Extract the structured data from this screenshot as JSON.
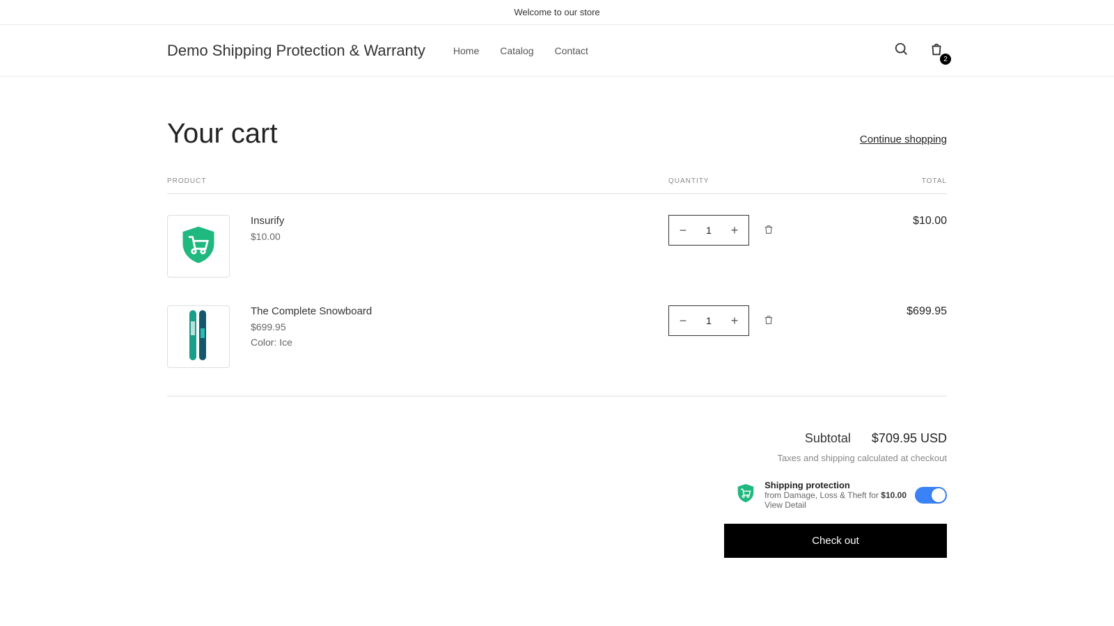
{
  "announcement": "Welcome to our store",
  "logo": "Demo Shipping Protection & Warranty",
  "nav": {
    "home": "Home",
    "catalog": "Catalog",
    "contact": "Contact"
  },
  "cart_badge": "2",
  "page": {
    "title": "Your cart",
    "continue": "Continue shopping"
  },
  "table": {
    "product": "PRODUCT",
    "quantity": "QUANTITY",
    "total": "TOTAL"
  },
  "items": [
    {
      "name": "Insurify",
      "price": "$10.00",
      "variant": "",
      "qty": "1",
      "total": "$10.00"
    },
    {
      "name": "The Complete Snowboard",
      "price": "$699.95",
      "variant": "Color: Ice",
      "qty": "1",
      "total": "$699.95"
    }
  ],
  "summary": {
    "subtotal_label": "Subtotal",
    "subtotal_value": "$709.95 USD",
    "tax_note": "Taxes and shipping calculated at checkout"
  },
  "protection": {
    "title": "Shipping protection",
    "desc_prefix": "from Damage, Loss & Theft for ",
    "price": "$10.00",
    "view_detail": "View Detail"
  },
  "checkout": "Check out"
}
